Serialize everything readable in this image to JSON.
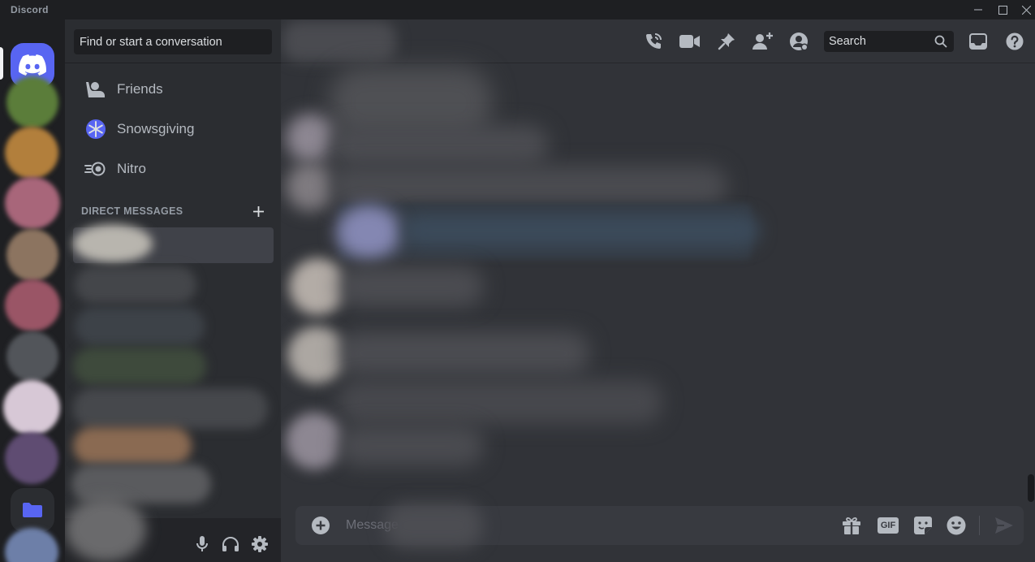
{
  "app": {
    "title": "Discord"
  },
  "colors": {
    "accent": "#5865f2",
    "bg_main": "#313338",
    "bg_sidebar": "#2b2d31",
    "bg_rail": "#1e1f22",
    "text_muted": "#b5bac1"
  },
  "window_controls": [
    "minimize-icon",
    "maximize-icon",
    "close-icon"
  ],
  "sidebar": {
    "search_placeholder": "Find or start a conversation",
    "nav": [
      {
        "label": "Friends",
        "icon": "friends-icon"
      },
      {
        "label": "Snowsgiving",
        "icon": "snowflake-icon"
      },
      {
        "label": "Nitro",
        "icon": "nitro-icon"
      }
    ],
    "dm_header": "DIRECT MESSAGES",
    "dm_add_icon": "plus-icon",
    "user_controls": [
      "microphone-icon",
      "headphones-icon",
      "settings-icon"
    ]
  },
  "topbar": {
    "buttons": [
      "voice-call-icon",
      "video-call-icon",
      "pin-icon",
      "add-friend-icon",
      "profile-icon"
    ],
    "search_placeholder": "Search",
    "right_buttons": [
      "inbox-icon",
      "help-icon"
    ]
  },
  "composer": {
    "placeholder": "Message",
    "buttons": [
      "add-attachment-icon",
      "gift-icon",
      "gif-icon",
      "sticker-icon",
      "emoji-icon",
      "send-icon"
    ],
    "gif_label": "GIF"
  }
}
